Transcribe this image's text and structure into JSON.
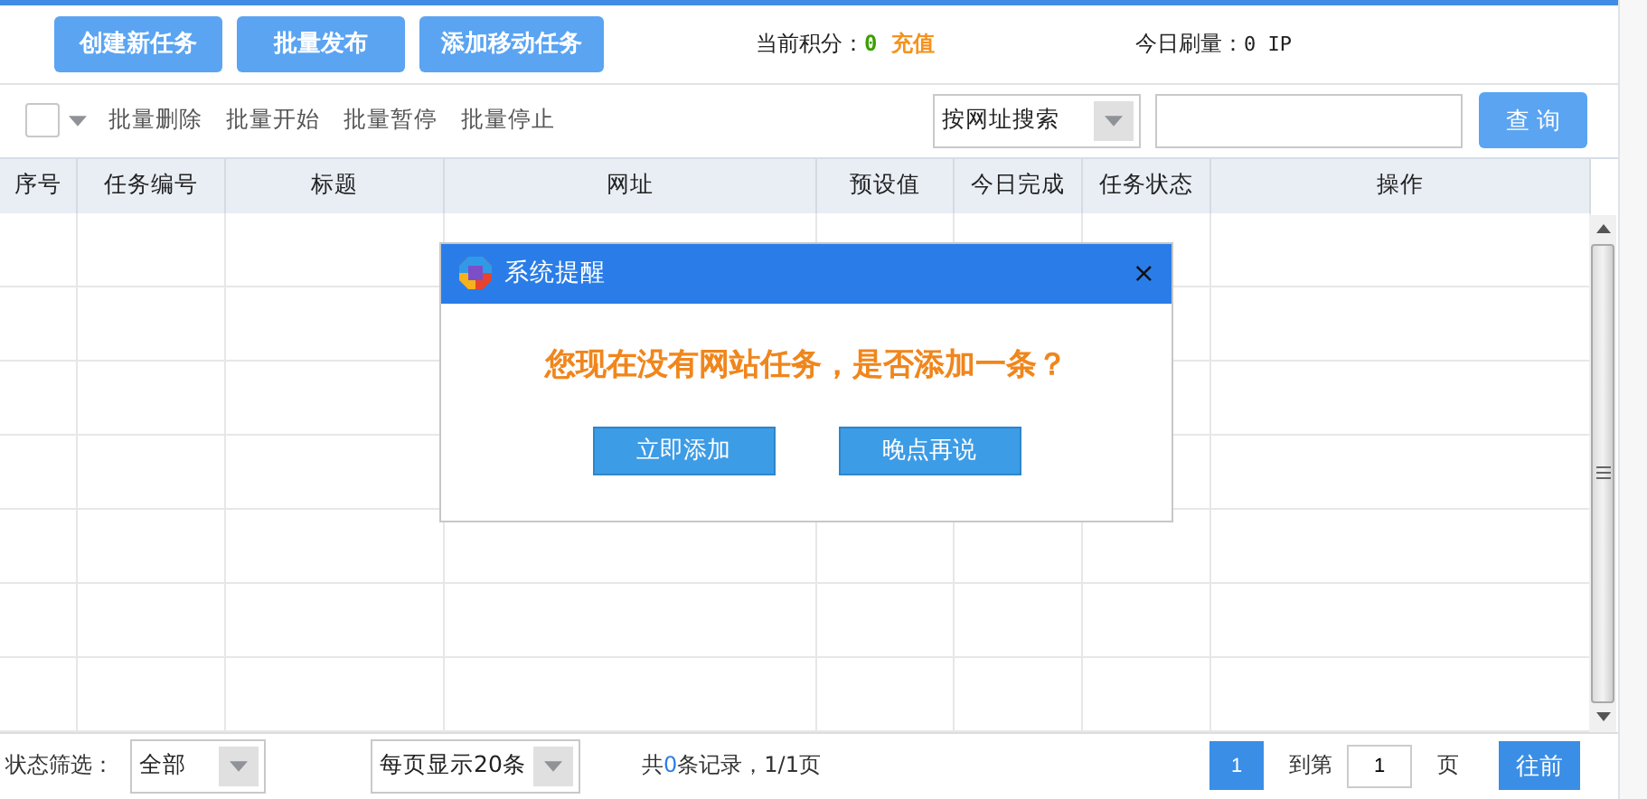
{
  "top_buttons": [
    "创建新任务",
    "批量发布",
    "添加移动任务"
  ],
  "points": {
    "label": "当前积分：",
    "value": "0",
    "recharge": "充值"
  },
  "today": {
    "label": "今日刷量：",
    "value": "0 IP"
  },
  "toolbar": {
    "select_all": {
      "checked": false
    },
    "actions": [
      "批量删除",
      "批量开始",
      "批量暂停",
      "批量停止"
    ],
    "search_type": "按网址搜索",
    "query_button": "查 询"
  },
  "table": {
    "columns": [
      "序号",
      "任务编号",
      "标题",
      "网址",
      "预设值",
      "今日完成",
      "任务状态",
      "操作"
    ]
  },
  "dialog": {
    "title": "系统提醒",
    "close": "×",
    "message": "您现在没有网站任务，是否添加一条？",
    "buttons": [
      "立即添加",
      "晚点再说"
    ]
  },
  "footer": {
    "filter_label": "状态筛选：",
    "filter_value": "全部",
    "page_size": "每页显示20条",
    "records": {
      "prefix": "共",
      "count": "0",
      "suffix": "条记录，1/1页"
    },
    "pages": [
      {
        "label": "1",
        "selected": true
      }
    ],
    "goto_label": "到第",
    "goto_value": "1",
    "page_unit": "页",
    "go_button": "往前"
  }
}
